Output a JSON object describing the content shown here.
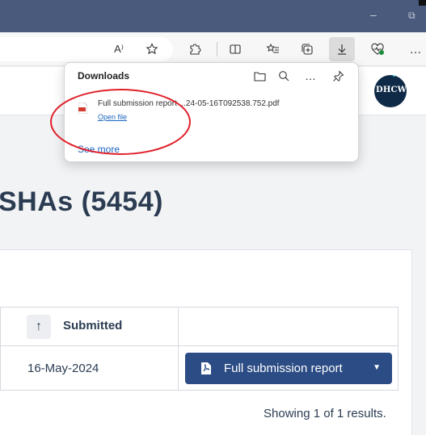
{
  "browser": {
    "toolbar_icons": [
      "read-aloud-icon",
      "favorite-star-icon",
      "extensions-icon",
      "split-screen-icon",
      "favorites-icon",
      "collections-icon",
      "downloads-icon",
      "browser-essentials-icon",
      "more-icon"
    ],
    "toolbar_glyphs": {
      "read_aloud": "A⁾",
      "more": "…"
    }
  },
  "downloads": {
    "title": "Downloads",
    "items": [
      {
        "file_name": "Full submission report ...24-05-16T092538.752.pdf",
        "action": "Open file"
      }
    ],
    "see_more": "See more",
    "more_glyph": "…"
  },
  "header": {
    "logo_text": "DHCW"
  },
  "main": {
    "heading": "SHAs (5454)",
    "table": {
      "columns": [
        {
          "label": "Submitted",
          "sort_glyph": "↑"
        }
      ],
      "rows": [
        {
          "submitted": "16-May-2024",
          "action_label": "Full submission report"
        }
      ]
    },
    "pagination": {
      "prefix": "Showing ",
      "current": "1",
      "middle": " of ",
      "total": "1",
      "suffix": " results."
    }
  },
  "colors": {
    "titlebar": "#4a5a7c",
    "primary_button": "#2b4c84",
    "heading": "#2b3c52",
    "link": "#1a65c0",
    "annotation": "#e0202a"
  }
}
